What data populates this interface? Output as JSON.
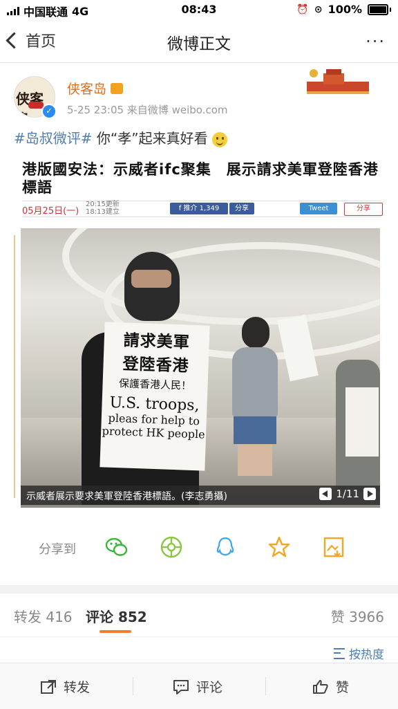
{
  "status_bar": {
    "carrier": "中国联通",
    "network": "4G",
    "time": "08:43",
    "battery": "100%"
  },
  "nav": {
    "back_label": "首页",
    "title": "微博正文",
    "more": "···"
  },
  "post": {
    "avatar_text": "侠客岛",
    "username": "侠客岛",
    "meta": "5-25 23:05  来自微博 weibo.com",
    "hashtag": "#岛叔微评#",
    "text": " 你“孝”起来真好看"
  },
  "news_image": {
    "headline": "港版國安法：示威者ifc聚集　展示請求美軍登陸香港標語",
    "date": "05月25日(一)",
    "updated_1": "20:15更新",
    "updated_2": "18:13建立",
    "fb_label": "f 推介 1,349",
    "share_label": "分享",
    "tweet_label": "Tweet",
    "weibo_label": "分享",
    "sign_lines": [
      "請求美軍",
      "登陸香港",
      "保護香港人民！",
      "U.S. troops,",
      "pleas for help to",
      "protect HK people"
    ],
    "caption": "示威者展示要求美軍登陸香港標語。(李志勇攝)",
    "counter": "1/11"
  },
  "share_row": {
    "label": "分享到",
    "icons": [
      "wechat-icon",
      "moments-icon",
      "qq-icon",
      "favorite-star-icon",
      "save-image-icon"
    ],
    "colors": {
      "wechat": "#3bb53b",
      "moments": "#8cc63f",
      "qq": "#3ba5f0",
      "star": "#f5a623",
      "save": "#f5a623"
    }
  },
  "tabs": {
    "repost": "转发 416",
    "comment": "评论 852",
    "like": "赞 3966"
  },
  "sort_label": "按热度",
  "bottom_bar": {
    "repost": "转发",
    "comment": "评论",
    "like": "赞"
  },
  "colors": {
    "accent": "#f47c30",
    "link": "#507daf",
    "username": "#e36c1c"
  }
}
